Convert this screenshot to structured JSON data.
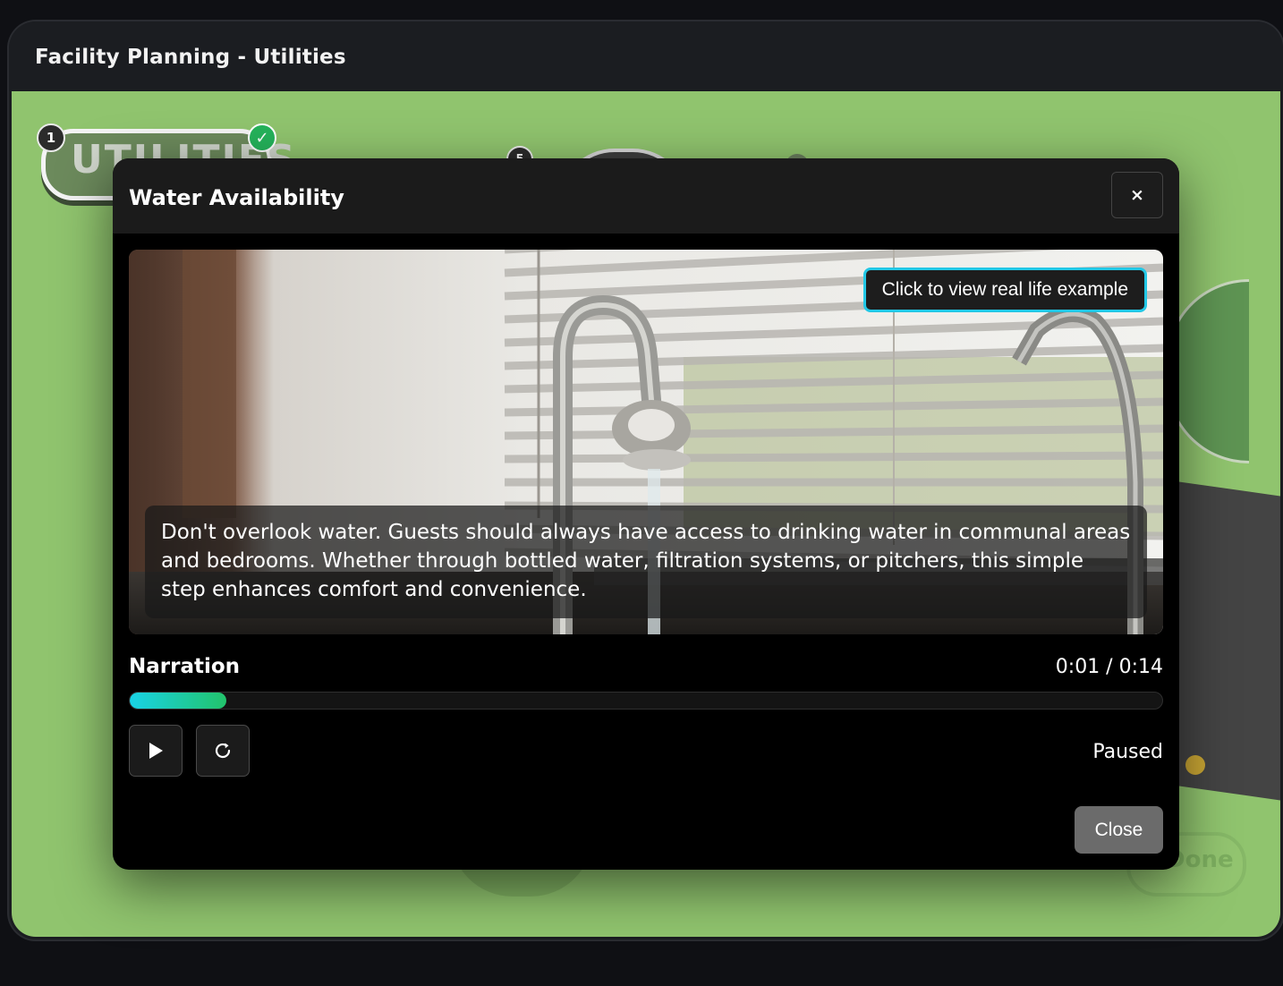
{
  "app": {
    "title": "Facility Planning - Utilities"
  },
  "scene": {
    "step1_badge": "1",
    "step1_label": "UTILITIES",
    "step5_badge": "5",
    "check_icon": "✓",
    "done_label": "Done"
  },
  "modal": {
    "title": "Water Availability",
    "close_x": "×",
    "real_life_button": "Click to view real life example",
    "caption": "Don't overlook water. Guests should always have access to drinking water in communal areas and bedrooms. Whether through bottled water, filtration systems, or pitchers, this simple step enhances comfort and convenience.",
    "narration_label": "Narration",
    "time": "0:01 / 0:14",
    "progress_fraction": 0.094,
    "status": "Paused",
    "close_button": "Close",
    "icons": {
      "play": "play-icon",
      "replay": "replay-icon"
    },
    "colors": {
      "accent": "#22c8e6",
      "progress_start": "#19d3e6",
      "progress_end": "#22c36b"
    }
  }
}
